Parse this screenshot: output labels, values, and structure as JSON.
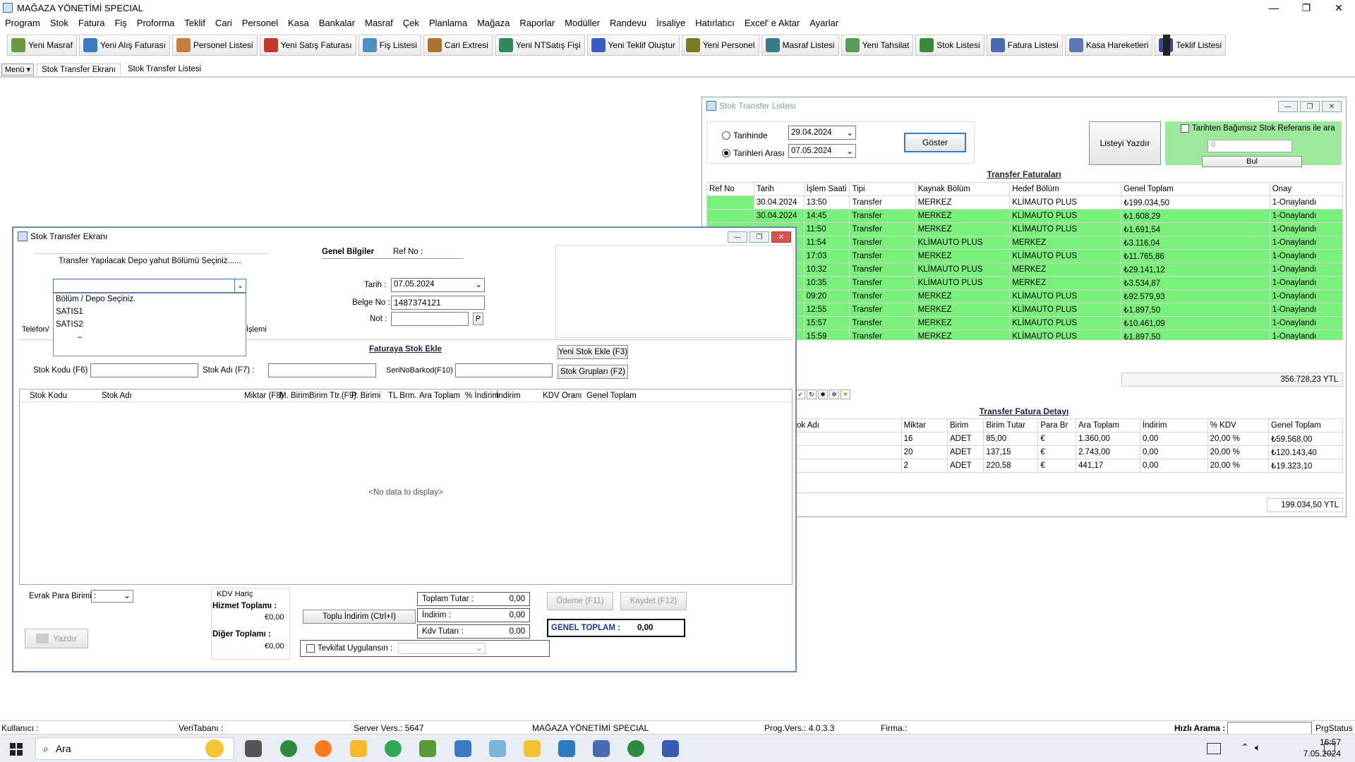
{
  "app": {
    "title": "MAĞAZA YÖNETİMİ SPECIAL"
  },
  "menu": [
    "Program",
    "Stok",
    "Fatura",
    "Fiş",
    "Proforma",
    "Teklif",
    "Cari",
    "Personel",
    "Kasa",
    "Bankalar",
    "Masraf",
    "Çek",
    "Planlama",
    "Mağaza",
    "Raporlar",
    "Modüller",
    "Randevu",
    "İrsaliye",
    "Hatırlatıcı",
    "Excel' e Aktar",
    "Ayarlar"
  ],
  "toolbar": [
    "Yeni Masraf",
    "Yeni Alış Faturası",
    "Personel Listesi",
    "Yeni Satış Faturası",
    "Fiş Listesi",
    "Cari Extresi",
    "Yeni NTSatış Fişi",
    "Yeni Teklif Oluştur",
    "Yeni Personel",
    "Masraf Listesi",
    "Yeni Tahsilat",
    "Stok Listesi",
    "Fatura Listesi",
    "Kasa Hareketleri",
    "Teklif Listesi"
  ],
  "toolbar_colors": [
    "#6b9a3e",
    "#3b7bc4",
    "#c77d3a",
    "#c0392b",
    "#4a90c0",
    "#b07030",
    "#2e8b57",
    "#3b5bc4",
    "#7a7a20",
    "#3a7a8a",
    "#5a9a5a",
    "#3a8a3a",
    "#4a6ab4",
    "#5a7ab4",
    "#3a4a94"
  ],
  "tabs": {
    "menu": "Menü",
    "items": [
      "Stok Transfer Ekranı",
      "Stok Transfer Listesi"
    ]
  },
  "list_window": {
    "title": "Stok Transfer Listesi",
    "radio_tarihinde": "Tarihinde",
    "radio_tarihleri_arasi": "Tarihleri Arası",
    "date1": "29.04.2024",
    "date2": "07.05.2024",
    "goster": "Göster",
    "listeyi_yazdir": "Listeyi Yazdır",
    "checkbox_label": "Tarihten Bağımsız Stok Referans ile ara",
    "search_value": "0",
    "bul": "Bul",
    "faturalar_title": "Transfer Faturaları",
    "faturalar_headers": [
      "Ref No",
      "Tarih",
      "İşlem Saati",
      "Tipi",
      "Kaynak Bölüm",
      "Hedef Bölüm",
      "Genel Toplam",
      "Onay"
    ],
    "faturalar_rows": [
      [
        "",
        "30.04.2024",
        "13:50",
        "Transfer",
        "MERKEZ",
        "KLİMAUTO PLUS",
        "₺199.034,50",
        "1-Onaylandı"
      ],
      [
        "",
        "30.04.2024",
        "14:45",
        "Transfer",
        "MERKEZ",
        "KLİMAUTO PLUS",
        "₺1.608,29",
        "1-Onaylandı"
      ],
      [
        "",
        "",
        "11:50",
        "Transfer",
        "MERKEZ",
        "KLİMAUTO PLUS",
        "₺1.691,54",
        "1-Onaylandı"
      ],
      [
        "",
        "",
        "11:54",
        "Transfer",
        "KLİMAUTO PLUS",
        "MERKEZ",
        "₺3.116,04",
        "1-Onaylandı"
      ],
      [
        "",
        "",
        "17:03",
        "Transfer",
        "MERKEZ",
        "KLİMAUTO PLUS",
        "₺11.765,86",
        "1-Onaylandı"
      ],
      [
        "",
        "",
        "10:32",
        "Transfer",
        "KLİMAUTO PLUS",
        "MERKEZ",
        "₺29.141,12",
        "1-Onaylandı"
      ],
      [
        "",
        "",
        "10:35",
        "Transfer",
        "KLİMAUTO PLUS",
        "MERKEZ",
        "₺3.534,87",
        "1-Onaylandı"
      ],
      [
        "",
        "",
        "09:20",
        "Transfer",
        "MERKEZ",
        "KLİMAUTO PLUS",
        "₺92.579,93",
        "1-Onaylandı"
      ],
      [
        "",
        "",
        "12:55",
        "Transfer",
        "MERKEZ",
        "KLİMAUTO PLUS",
        "₺1.897,50",
        "1-Onaylandı"
      ],
      [
        "",
        "",
        "15:57",
        "Transfer",
        "MERKEZ",
        "KLİMAUTO PLUS",
        "₺10.461,09",
        "1-Onaylandı"
      ],
      [
        "",
        "",
        "15:59",
        "Transfer",
        "MERKEZ",
        "KLİMAUTO PLUS",
        "₺1.897,50",
        "1-Onaylandı"
      ]
    ],
    "faturalar_total": "356.728,23 YTL",
    "detay_title": "Transfer Fatura Detayı",
    "detay_headers": [
      "ok Adı",
      "Miktar",
      "Birim",
      "Birim Tutar",
      "Para Br",
      "Ara Toplam",
      "İndirim",
      "% KDV",
      "Genel Toplam"
    ],
    "detay_rows": [
      [
        "",
        "16",
        "ADET",
        "85,00",
        "€",
        "1.360,00",
        "0,00",
        "20,00 %",
        "₺59.568,00"
      ],
      [
        "",
        "20",
        "ADET",
        "137,15",
        "€",
        "2.743,00",
        "0,00",
        "20,00 %",
        "₺120.143,40"
      ],
      [
        "",
        "2",
        "ADET",
        "220,58",
        "€",
        "441,17",
        "0,00",
        "20,00 %",
        "₺19.323,10"
      ]
    ],
    "detay_total": "199.034,50 YTL"
  },
  "transfer_window": {
    "title": "Stok Transfer Ekranı",
    "group_label": "Transfer Yapılacak Depo yahut Bölümü Seçiniz......",
    "dropdown_options": [
      "Bölüm / Depo Seçiniz.",
      "SATIS1",
      "SATIS2",
      "–"
    ],
    "telefon_label": "Telefon/",
    "islemi_label": "İşlemi",
    "genel_bilgiler": "Genel Bilgiler",
    "ref_no": "Ref No :",
    "tarih_label": "Tarih :",
    "tarih_value": "07.05.2024",
    "belge_label": "Belge No :",
    "belge_value": "1487374121",
    "not_label": "Not :",
    "p_btn": "P",
    "faturaya_stok_ekle": "Faturaya Stok Ekle",
    "yeni_stok_ekle": "Yeni Stok Ekle (F3)",
    "stok_gruplari": "Stok Grupları (F2)",
    "stok_kodu_label": "Stok Kodu (F6) :",
    "stok_adi_label": "Stok Adı (F7) :",
    "seri_label": "SeriNoBarkod(F10)",
    "grid_headers": [
      "Stok Kodu",
      "Stok Adı",
      "Miktar (F8)",
      "M. Birim",
      "Birim Ttr.(F9)",
      "P. Birimi",
      "TL Brm.",
      "Ara Toplam",
      "% İndirim",
      "İndirim",
      "KDV Oranı",
      "Genel Toplam"
    ],
    "no_data": "<No data to display>",
    "evrak_label": "Evrak Para Birimi :",
    "yazdir": "Yazdır",
    "kdv_haric": "KDV Hariç",
    "hizmet_label": "Hizmet Toplamı :",
    "hizmet_value": "€0,00",
    "diger_label": "Diğer Toplamı :",
    "diger_value": "€0,00",
    "toplu_indirim": "Toplu İndirim (Ctrl+I)",
    "toplam_tutar_label": "Toplam Tutar :",
    "toplam_tutar_value": "0,00",
    "indirim_label": "İndirim :",
    "indirim_value": "0,00",
    "kdv_tutari_label": "Kdv Tutarı :",
    "kdv_tutari_value": "0,00",
    "odeme": "Ödeme (F11)",
    "kaydet": "Kaydet (F12)",
    "genel_toplam_label": "GENEL TOPLAM :",
    "genel_toplam_value": "0,00",
    "tevkifat_label": "Tevkifat Uygulansın :"
  },
  "statusbar": {
    "kullanici": "Kullanıcı :",
    "veritabani": "VeriTabanı :",
    "server": "Server Vers.: 5647",
    "app": "MAĞAZA YÖNETİMİ SPECIAL",
    "prog": "Prog.Vers.: 4.0.3.3",
    "firma": "Firma.:",
    "hizli_arama": "Hızlı Arama :",
    "prgstatus": "PrgStatus"
  },
  "taskbar": {
    "search": "Ara",
    "time": "16:57",
    "date": "7.05.2024"
  }
}
